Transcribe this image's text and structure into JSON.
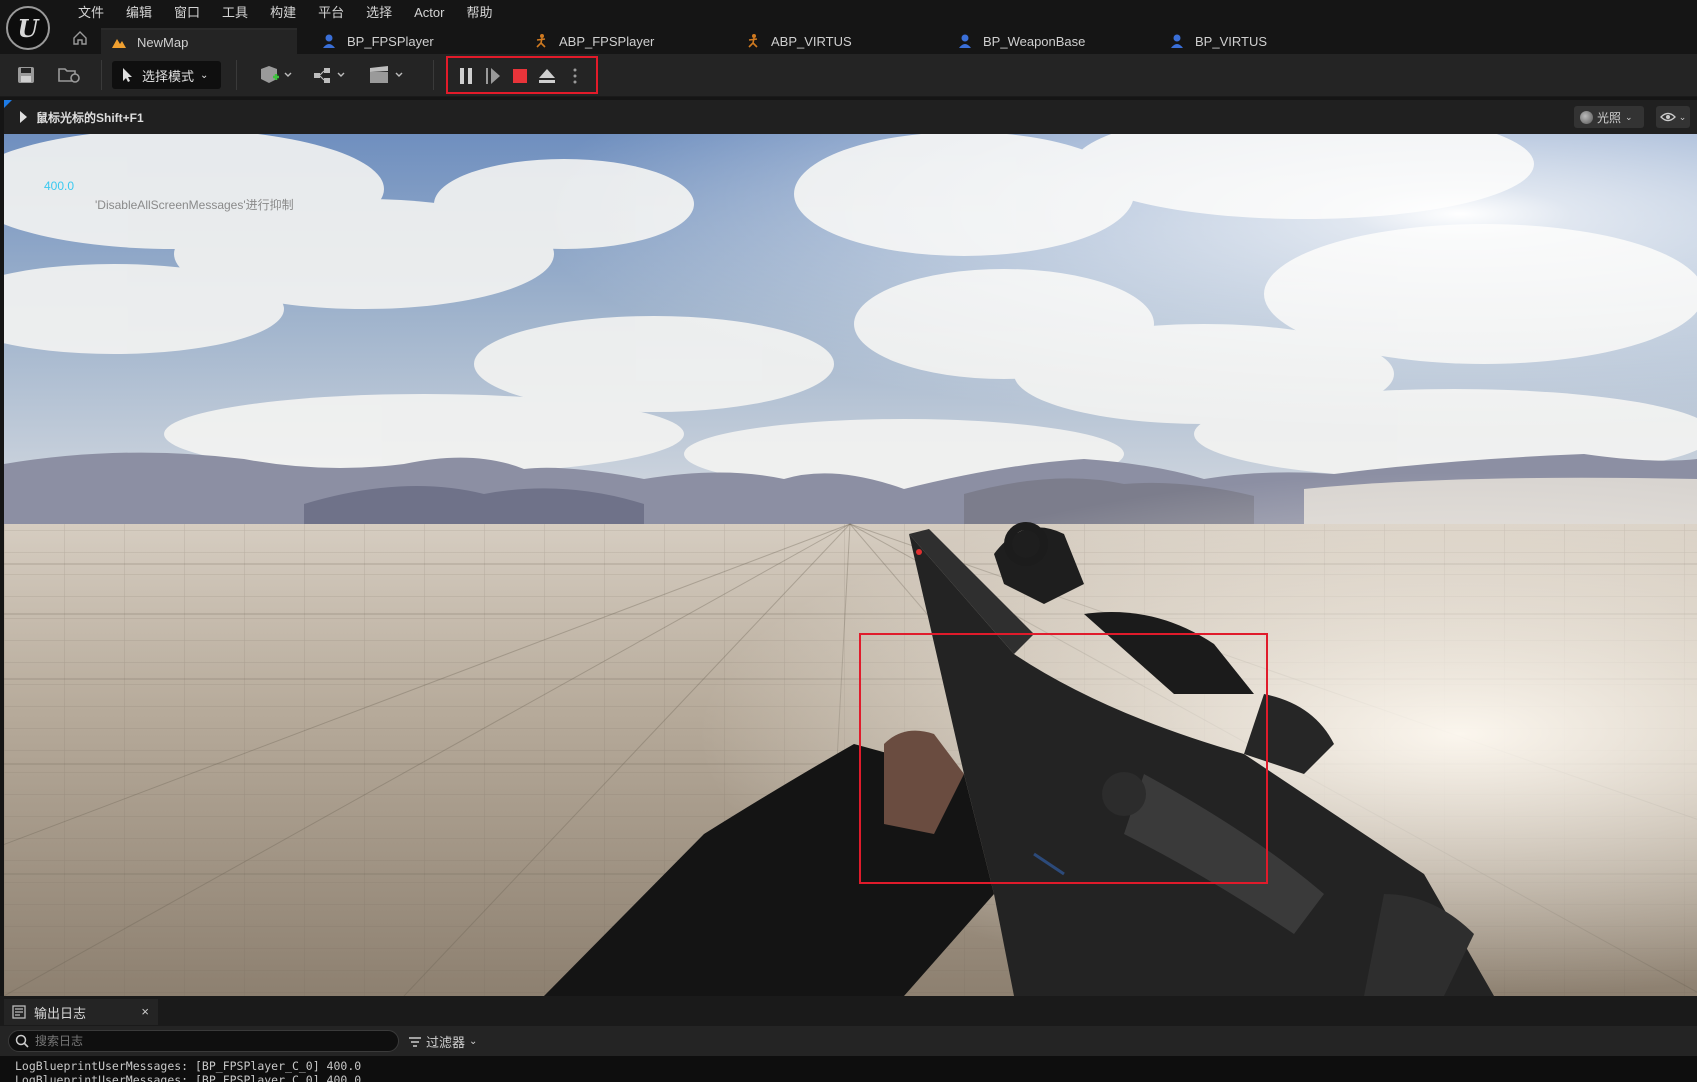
{
  "menu": [
    "文件",
    "编辑",
    "窗口",
    "工具",
    "构建",
    "平台",
    "选择",
    "Actor",
    "帮助"
  ],
  "tabs": [
    {
      "label": "NewMap",
      "icon": "level-icon",
      "active": true
    },
    {
      "label": "BP_FPSPlayer",
      "icon": "blueprint-icon"
    },
    {
      "label": "ABP_FPSPlayer",
      "icon": "anim-blueprint-icon"
    },
    {
      "label": "ABP_VIRTUS",
      "icon": "anim-blueprint-icon"
    },
    {
      "label": "BP_WeaponBase",
      "icon": "blueprint-icon"
    },
    {
      "label": "BP_VIRTUS",
      "icon": "blueprint-icon"
    }
  ],
  "toolbar": {
    "mode_label": "选择模式",
    "play_controls": [
      "pause",
      "step-frame",
      "stop",
      "eject",
      "more-options"
    ]
  },
  "viewport": {
    "hint": "鼠标光标的Shift+F1",
    "lighting_label": "光照",
    "debug_value": "400.0",
    "debug_message": "'DisableAllScreenMessages'进行抑制"
  },
  "output_log": {
    "tab_label": "输出日志",
    "close": "×",
    "search_placeholder": "搜索日志",
    "filter_label": "过滤器",
    "lines": [
      "LogBlueprintUserMessages: [BP_FPSPlayer_C_0] 400.0",
      "LogBlueprintUserMessages: [BP_FPSPlayer_C_0] 400.0"
    ]
  },
  "colors": {
    "highlight": "#e21b2a",
    "debug_text": "#3ac9f0",
    "stop_button": "#e8343a"
  }
}
